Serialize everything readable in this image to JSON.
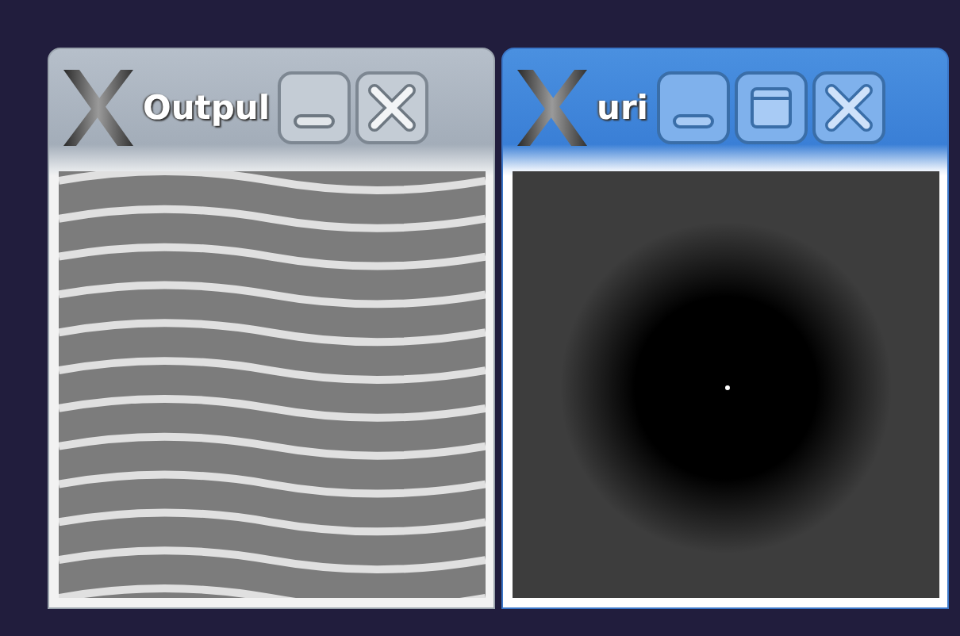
{
  "windows": [
    {
      "title": "Outpul",
      "active": false,
      "buttons": [
        {
          "kind": "minimize"
        },
        {
          "kind": "close"
        }
      ],
      "content": {
        "kind": "picture"
      }
    },
    {
      "title": "uri",
      "active": true,
      "buttons": [
        {
          "kind": "minimize"
        },
        {
          "kind": "maximize"
        },
        {
          "kind": "close"
        }
      ],
      "content": {
        "kind": "picture"
      }
    }
  ]
}
